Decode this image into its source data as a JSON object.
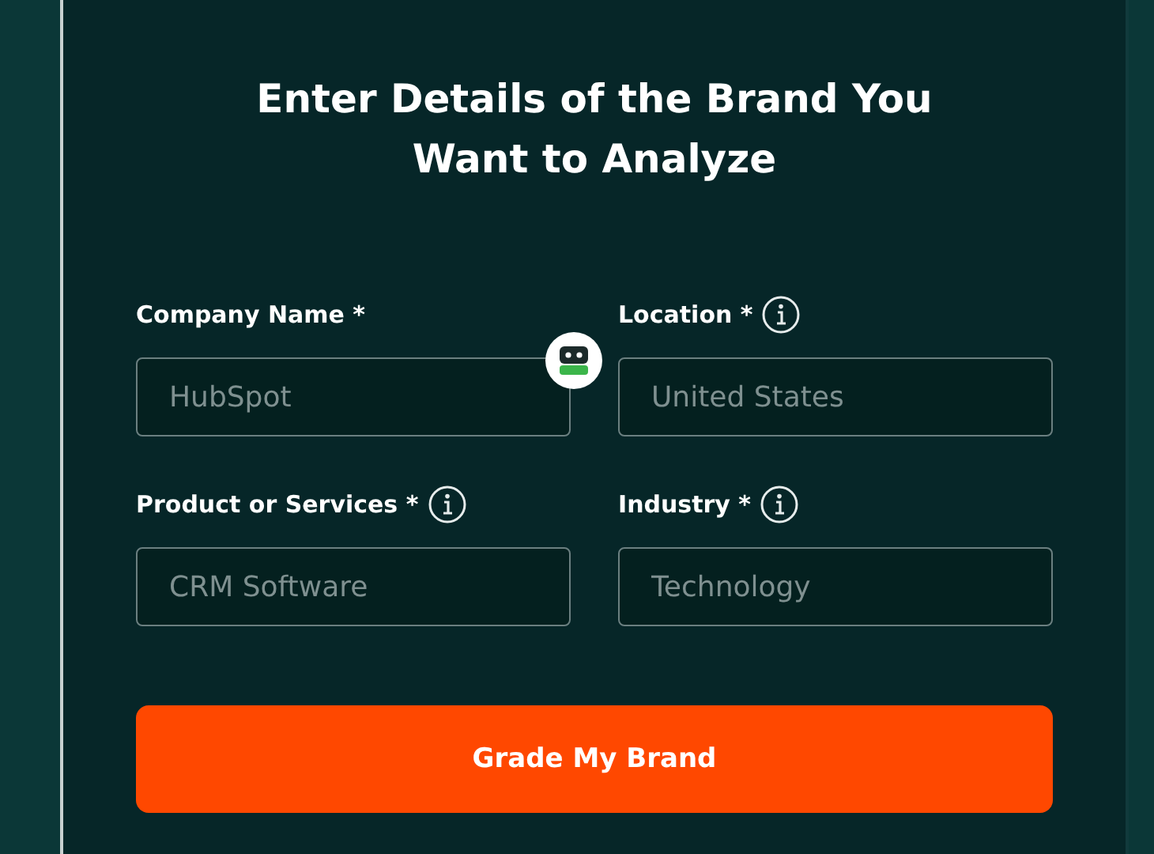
{
  "heading": {
    "line_1": "Enter Details of the Brand You",
    "line_2": "Want to Analyze"
  },
  "fields": [
    {
      "label": "Company Name *",
      "info": false,
      "placeholder": "HubSpot"
    },
    {
      "label": "Location *",
      "info": true,
      "placeholder": "United States"
    },
    {
      "label": "Product or Services *",
      "info": true,
      "placeholder": "CRM Software"
    },
    {
      "label": "Industry *",
      "info": true,
      "placeholder": "Technology"
    }
  ],
  "submit": "Grade My Brand"
}
